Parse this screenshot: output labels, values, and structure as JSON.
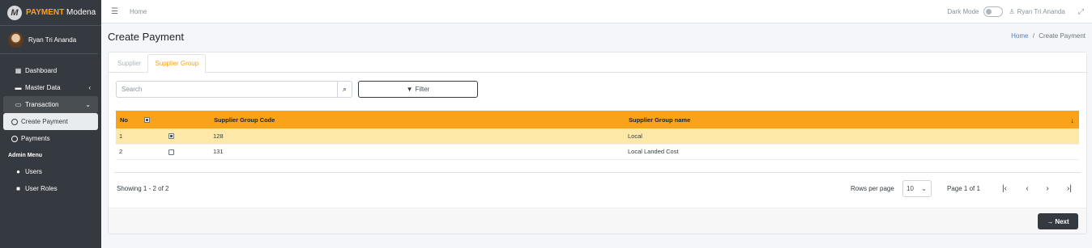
{
  "brand": {
    "logo_letter": "M",
    "name_accent": "PAYMENT",
    "name_rest": "Modena"
  },
  "user": {
    "name": "Ryan Tri Ananda"
  },
  "sidebar": {
    "items": [
      {
        "label": "Dashboard",
        "icon": "grid-icon"
      },
      {
        "label": "Master Data",
        "icon": "database-icon"
      },
      {
        "label": "Transaction",
        "icon": "credit-card-icon"
      },
      {
        "label": "Create Payment",
        "icon": "circle-icon"
      },
      {
        "label": "Payments",
        "icon": "circle-icon"
      }
    ],
    "admin_header": "Admin Menu",
    "admin_items": [
      {
        "label": "Users",
        "icon": "users-icon"
      },
      {
        "label": "User Roles",
        "icon": "lock-icon"
      }
    ]
  },
  "topbar": {
    "home": "Home",
    "dark_mode_label": "Dark Mode",
    "user_name": "Ryan Tri Ananda"
  },
  "page": {
    "title": "Create Payment"
  },
  "breadcrumb": {
    "home": "Home",
    "separator": "/",
    "current": "Create Payment"
  },
  "tabs": [
    {
      "label": "Supplier"
    },
    {
      "label": "Supplier Group"
    }
  ],
  "search": {
    "placeholder": "Search"
  },
  "filter": {
    "label": "Filter"
  },
  "table": {
    "headers": {
      "no": "No",
      "code": "Supplier Group Code",
      "name": "Supplier Group name"
    },
    "rows": [
      {
        "no": "1",
        "checked": true,
        "code": "128",
        "name": "Local"
      },
      {
        "no": "2",
        "checked": false,
        "code": "131",
        "name": "Local Landed Cost"
      }
    ]
  },
  "pagination": {
    "showing": "Showing 1 - 2 of 2",
    "rows_per_page_label": "Rows per page",
    "rows_per_page_value": "10",
    "page_info": "Page 1 of 1"
  },
  "footer": {
    "next_label": "Next"
  },
  "colors": {
    "accent": "#f8a31b",
    "sidebar": "#343a40",
    "selected_row": "#fde8a8"
  }
}
